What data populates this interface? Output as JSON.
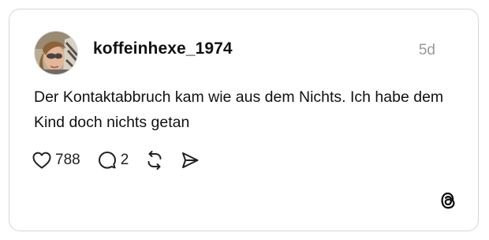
{
  "post": {
    "username": "koffeinhexe_1974",
    "timestamp": "5d",
    "text": "Der Kontaktabbruch kam wie aus dem Nichts. Ich habe dem Kind doch nichts getan"
  },
  "actions": {
    "like_count": "788",
    "comment_count": "2"
  },
  "icons": {
    "like": "heart-icon",
    "comment": "comment-bubble-icon",
    "repost": "repost-icon",
    "share": "send-icon",
    "brand": "threads-logo-icon"
  },
  "colors": {
    "border": "#d6d6d6",
    "timestamp": "#999999",
    "text": "#111111"
  }
}
